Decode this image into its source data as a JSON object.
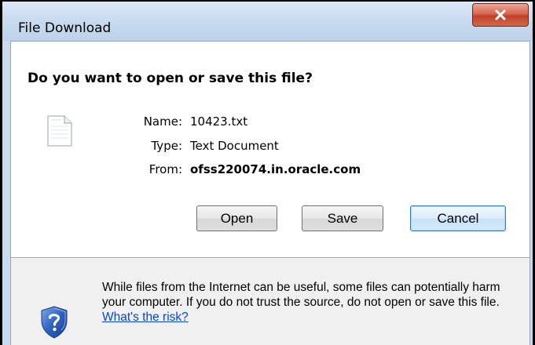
{
  "window": {
    "title": "File Download",
    "close_icon": "close-icon"
  },
  "dialog": {
    "question": "Do you want to open or save this file?",
    "file_icon": "text-file-icon",
    "name_label": "Name:",
    "name_value": "10423.txt",
    "type_label": "Type:",
    "type_value": "Text Document",
    "from_label": "From:",
    "from_value": "ofss220074.in.oracle.com"
  },
  "buttons": {
    "open": "Open",
    "save": "Save",
    "cancel": "Cancel",
    "default": "cancel"
  },
  "warning": {
    "icon": "shield-question-icon",
    "text": "While files from the Internet can be useful, some files can potentially harm your computer. If you do not trust the source, do not open or save this file.",
    "link": "What's the risk?"
  },
  "colors": {
    "titlebar": "#c6d9ee",
    "close_button": "#c2412a",
    "link": "#0645d6",
    "warning_background": "#f0f0f0",
    "shield": "#2f63c0"
  }
}
